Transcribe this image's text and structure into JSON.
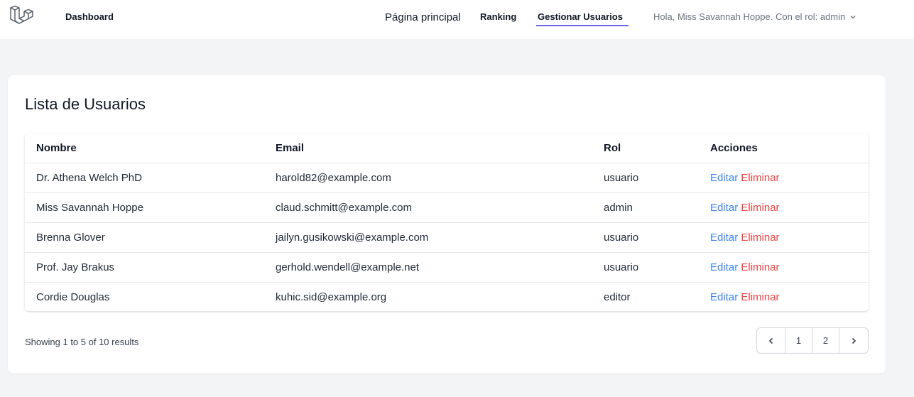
{
  "nav": {
    "dashboard": "Dashboard",
    "home": "Página principal",
    "ranking": "Ranking",
    "manage_users": "Gestionar Usuarios",
    "user_greeting": "Hola, Miss Savannah Hoppe. Con el rol: admin",
    "logo_icon": "laravel-logo-icon",
    "dropdown_icon": "chevron-down-icon"
  },
  "card": {
    "title": "Lista de Usuarios"
  },
  "table": {
    "headers": [
      "Nombre",
      "Email",
      "Rol",
      "Acciones"
    ],
    "rows": [
      {
        "name": "Dr. Athena Welch PhD",
        "email": "harold82@example.com",
        "role": "usuario",
        "edit": "Editar",
        "delete": "Eliminar"
      },
      {
        "name": "Miss Savannah Hoppe",
        "email": "claud.schmitt@example.com",
        "role": "admin",
        "edit": "Editar",
        "delete": "Eliminar"
      },
      {
        "name": "Brenna Glover",
        "email": "jailyn.gusikowski@example.com",
        "role": "usuario",
        "edit": "Editar",
        "delete": "Eliminar"
      },
      {
        "name": "Prof. Jay Brakus",
        "email": "gerhold.wendell@example.net",
        "role": "usuario",
        "edit": "Editar",
        "delete": "Eliminar"
      },
      {
        "name": "Cordie Douglas",
        "email": "kuhic.sid@example.org",
        "role": "editor",
        "edit": "Editar",
        "delete": "Eliminar"
      }
    ]
  },
  "pagination": {
    "summary": "Showing 1 to 5 of 10 results",
    "pages": [
      "1",
      "2"
    ],
    "prev_icon": "chevron-left-icon",
    "next_icon": "chevron-right-icon"
  },
  "colors": {
    "accent": "#6366f1",
    "edit": "#3b82f6",
    "delete": "#ef4444",
    "background": "#f3f4f6"
  }
}
